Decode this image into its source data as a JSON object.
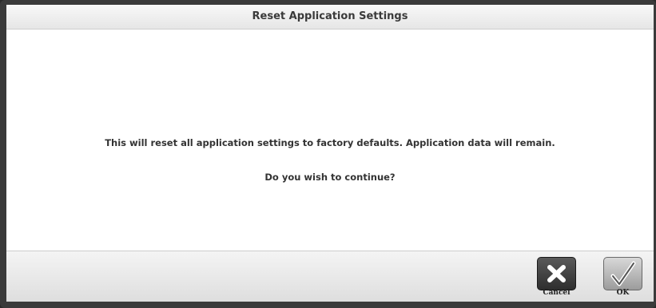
{
  "dialog": {
    "title": "Reset Application Settings",
    "message": "This will reset all application settings to factory defaults. Application data will remain.",
    "question": "Do you wish to continue?"
  },
  "buttons": {
    "cancel": {
      "label": "Cancel",
      "icon": "close-icon"
    },
    "ok": {
      "label": "OK",
      "icon": "checkmark-icon"
    }
  }
}
